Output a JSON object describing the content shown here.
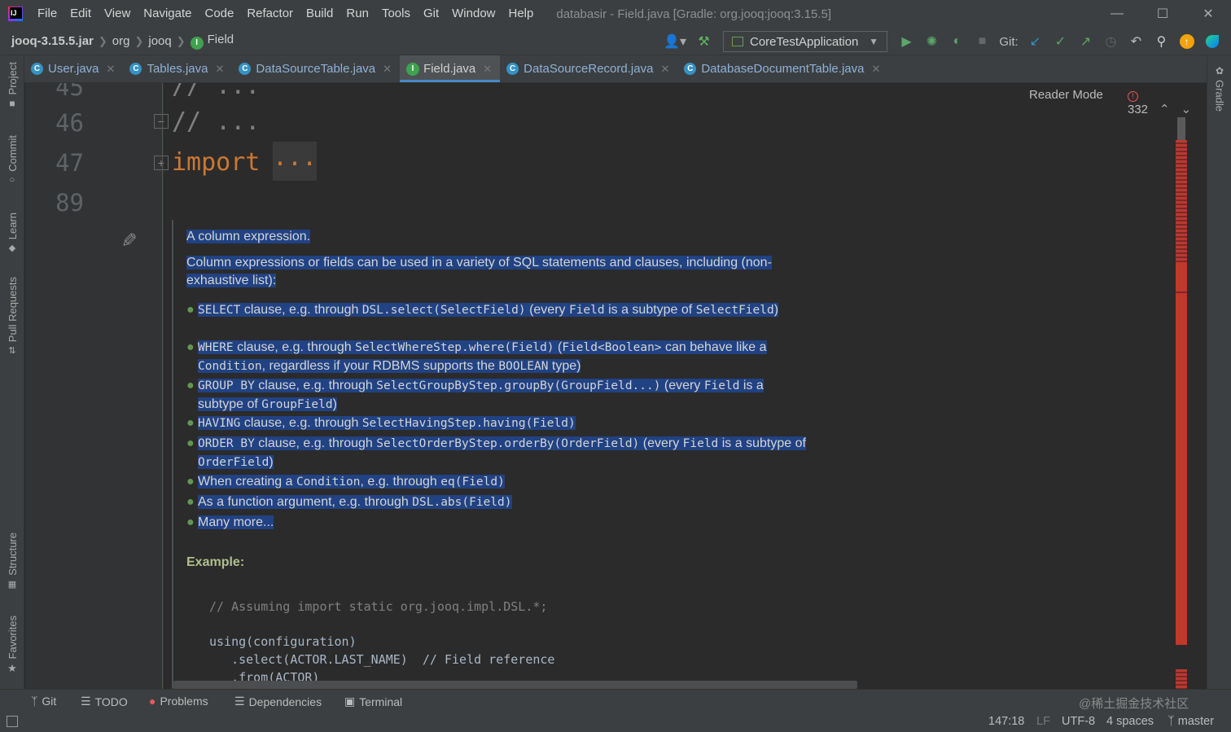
{
  "window": {
    "title": "databasir - Field.java [Gradle: org.jooq:jooq:3.15.5]",
    "menu": [
      "File",
      "Edit",
      "View",
      "Navigate",
      "Code",
      "Refactor",
      "Build",
      "Run",
      "Tools",
      "Git",
      "Window",
      "Help"
    ]
  },
  "breadcrumb": [
    "jooq-3.15.5.jar",
    "org",
    "jooq",
    "Field"
  ],
  "toolbar": {
    "run_config": "CoreTestApplication",
    "git_label": "Git:"
  },
  "tabs": [
    {
      "label": "User.java",
      "active": false
    },
    {
      "label": "Tables.java",
      "active": false
    },
    {
      "label": "DataSourceTable.java",
      "active": false
    },
    {
      "label": "Field.java",
      "active": true
    },
    {
      "label": "DataSourceRecord.java",
      "active": false
    },
    {
      "label": "DatabaseDocumentTable.java",
      "active": false
    }
  ],
  "left_tools": [
    "Project",
    "Commit",
    "Learn",
    "Pull Requests",
    "Structure",
    "Favorites"
  ],
  "right_tools": [
    "Gradle"
  ],
  "editor": {
    "line_numbers": [
      "45",
      "46",
      "47",
      "89"
    ],
    "line45_text": "// ...",
    "line46_text": "// ...",
    "import_kw": "import",
    "import_dots": "...",
    "reader_mode": "Reader Mode",
    "error_count": "332"
  },
  "doc": {
    "p1": "A column expression.",
    "p2": "Column expressions or fields can be used in a variety of SQL statements and clauses, including (non-exhaustive list):",
    "bullets": [
      [
        "SELECT",
        " clause, e.g. through ",
        "DSL.select(SelectField)",
        " (every ",
        "Field",
        " is a subtype of ",
        "SelectField",
        ")"
      ],
      [
        "WHERE",
        " clause, e.g. through ",
        "SelectWhereStep.where(Field)",
        " (",
        "Field<Boolean>",
        " can behave like a ",
        "Condition",
        ", regardless if your RDBMS supports the ",
        "BOOLEAN",
        " type)"
      ],
      [
        "GROUP BY",
        " clause, e.g. through ",
        "SelectGroupByStep.groupBy(GroupField...)",
        " (every ",
        "Field",
        " is a subtype of ",
        "GroupField",
        ")"
      ],
      [
        "HAVING",
        " clause, e.g. through ",
        "SelectHavingStep.having(Field)"
      ],
      [
        "ORDER BY",
        " clause, e.g. through ",
        "SelectOrderByStep.orderBy(OrderField)",
        " (every ",
        "Field",
        " is a subtype of ",
        "OrderField",
        ")"
      ],
      [
        "When creating a ",
        "Condition",
        ", e.g. through ",
        "eq(Field)"
      ],
      [
        "As a function argument, e.g. through ",
        "DSL.abs(Field)"
      ],
      [
        "Many more..."
      ]
    ],
    "example_label": "Example:",
    "example_code": [
      "// Assuming import static org.jooq.impl.DSL.*;",
      "",
      "using(configuration)",
      "   .select(ACTOR.LAST_NAME)  // Field reference",
      "   .from(ACTOR)"
    ]
  },
  "statusbar": {
    "tools": [
      "Git",
      "TODO",
      "Problems",
      "Dependencies",
      "Terminal"
    ],
    "position": "147:18",
    "line_sep": "LF",
    "encoding": "UTF-8",
    "indent": "4 spaces",
    "branch": "master",
    "watermark": "@稀土掘金技术社区"
  },
  "colors": {
    "selection": "#214283",
    "keyword": "#cc7832",
    "comment": "#808080",
    "bullet": "#629755",
    "error_stripe": "#c0392b"
  }
}
